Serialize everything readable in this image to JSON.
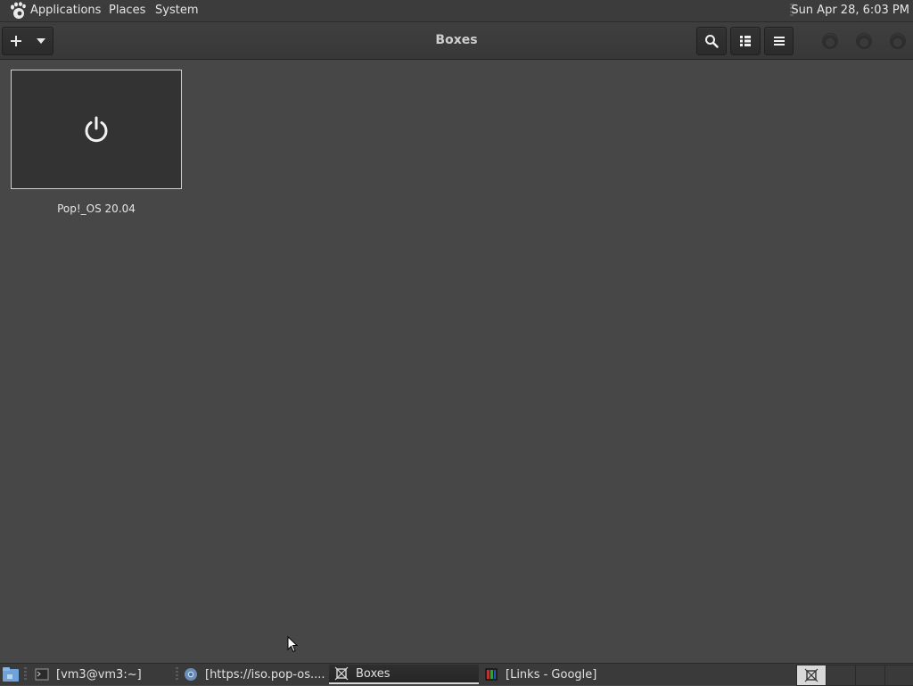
{
  "top_panel": {
    "menus": [
      "Applications",
      "Places",
      "System"
    ],
    "clock": "Sun Apr 28,  6:03 PM"
  },
  "headerbar": {
    "title": "Boxes",
    "icons": {
      "new": "plus-icon",
      "dropdown": "chevron-down-icon",
      "search": "search-icon",
      "view": "list-view-icon",
      "menu": "hamburger-menu-icon"
    }
  },
  "boxes": [
    {
      "name": "Pop!_OS 20.04",
      "state_icon": "power-icon"
    }
  ],
  "taskbar": {
    "tasks": [
      {
        "label": "[vm3@vm3:~]",
        "icon": "terminal-icon",
        "active": false
      },
      {
        "label": "[https://iso.pop-os....",
        "icon": "chromium-icon",
        "active": false
      },
      {
        "label": "Boxes",
        "icon": "boxes-icon",
        "active": true
      },
      {
        "label": "[Links - Google]",
        "icon": "links-icon",
        "active": false
      }
    ]
  },
  "colors": {
    "panel": "#3c3c3c",
    "headerbar": "#3a3a3a",
    "content": "#474747",
    "thumbnail": "#333333",
    "text": "#e6e6e6"
  }
}
